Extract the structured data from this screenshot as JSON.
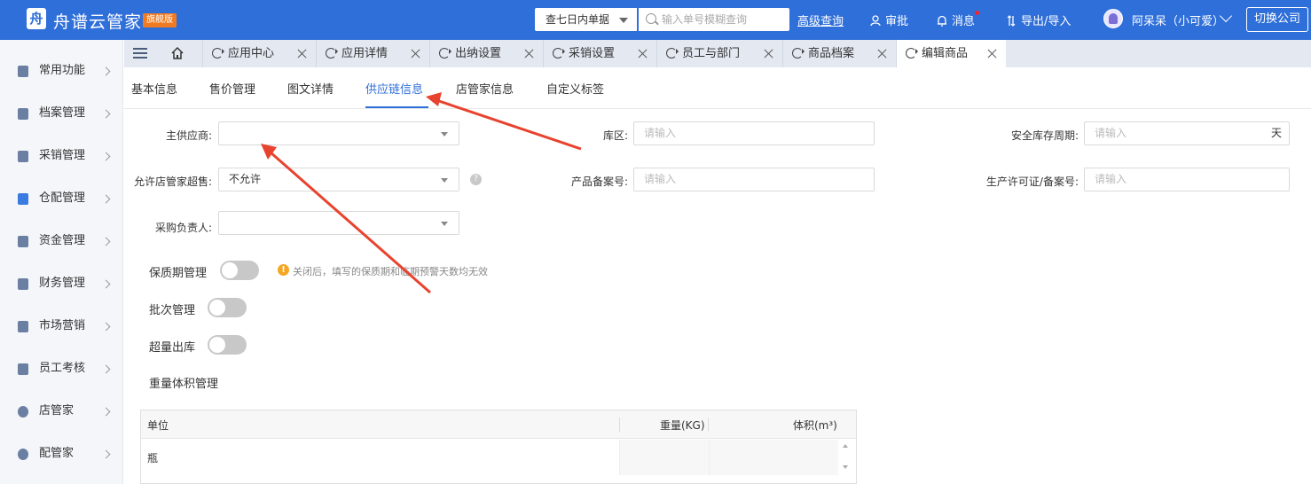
{
  "header": {
    "logo_char": "舟",
    "brand": "舟谱云管家",
    "edition": "旗舰版",
    "query_type": "查七日内单据",
    "search_placeholder": "输入单号模糊查询",
    "advanced_search": "高级查询",
    "approve": "审批",
    "messages": "消息",
    "export_import": "导出/导入",
    "user": "阿呆呆（小可爱）",
    "switch_company": "切换公司"
  },
  "sidebar": {
    "items": [
      {
        "label": "常用功能",
        "icon": "box-icon"
      },
      {
        "label": "档案管理",
        "icon": "grid-icon"
      },
      {
        "label": "采销管理",
        "icon": "clipboard-icon"
      },
      {
        "label": "仓配管理",
        "icon": "warehouse-icon"
      },
      {
        "label": "资金管理",
        "icon": "moneybag-icon"
      },
      {
        "label": "财务管理",
        "icon": "calculator-icon"
      },
      {
        "label": "市场营销",
        "icon": "shop-icon"
      },
      {
        "label": "员工考核",
        "icon": "users-icon"
      },
      {
        "label": "店管家",
        "icon": "store-icon"
      },
      {
        "label": "配管家",
        "icon": "chat-icon"
      }
    ]
  },
  "tabs": [
    {
      "label": "应用中心"
    },
    {
      "label": "应用详情"
    },
    {
      "label": "出纳设置"
    },
    {
      "label": "采销设置"
    },
    {
      "label": "员工与部门"
    },
    {
      "label": "商品档案"
    },
    {
      "label": "编辑商品"
    }
  ],
  "subtabs": [
    "基本信息",
    "售价管理",
    "图文详情",
    "供应链信息",
    "店管家信息",
    "自定义标签"
  ],
  "form": {
    "main_supplier_label": "主供应商:",
    "main_supplier_value": "",
    "zone_label": "库区:",
    "zone_placeholder": "请输入",
    "safety_cycle_label": "安全库存周期:",
    "safety_cycle_placeholder": "请输入",
    "safety_cycle_unit": "天",
    "allow_oversell_label": "允许店管家超售:",
    "allow_oversell_value": "不允许",
    "filing_no_label": "产品备案号:",
    "filing_no_placeholder": "请输入",
    "license_label": "生产许可证/备案号:",
    "license_placeholder": "请输入",
    "purchaser_label": "采购负责人:",
    "purchaser_value": ""
  },
  "toggles": {
    "shelf_life_label": "保质期管理",
    "shelf_life_on": false,
    "shelf_life_tip": "关闭后，填写的保质期和临期预警天数均无效",
    "batch_label": "批次管理",
    "batch_on": false,
    "overstock_label": "超量出库",
    "overstock_on": false
  },
  "weight_volume": {
    "title": "重量体积管理",
    "columns": [
      "单位",
      "重量(KG)",
      "体积(m³)"
    ],
    "rows": [
      {
        "unit": "瓶",
        "weight": "",
        "volume": ""
      }
    ]
  },
  "colors": {
    "primary": "#2f6fd9",
    "annotation_arrow": "#e8432e",
    "warning": "#f5a623"
  }
}
